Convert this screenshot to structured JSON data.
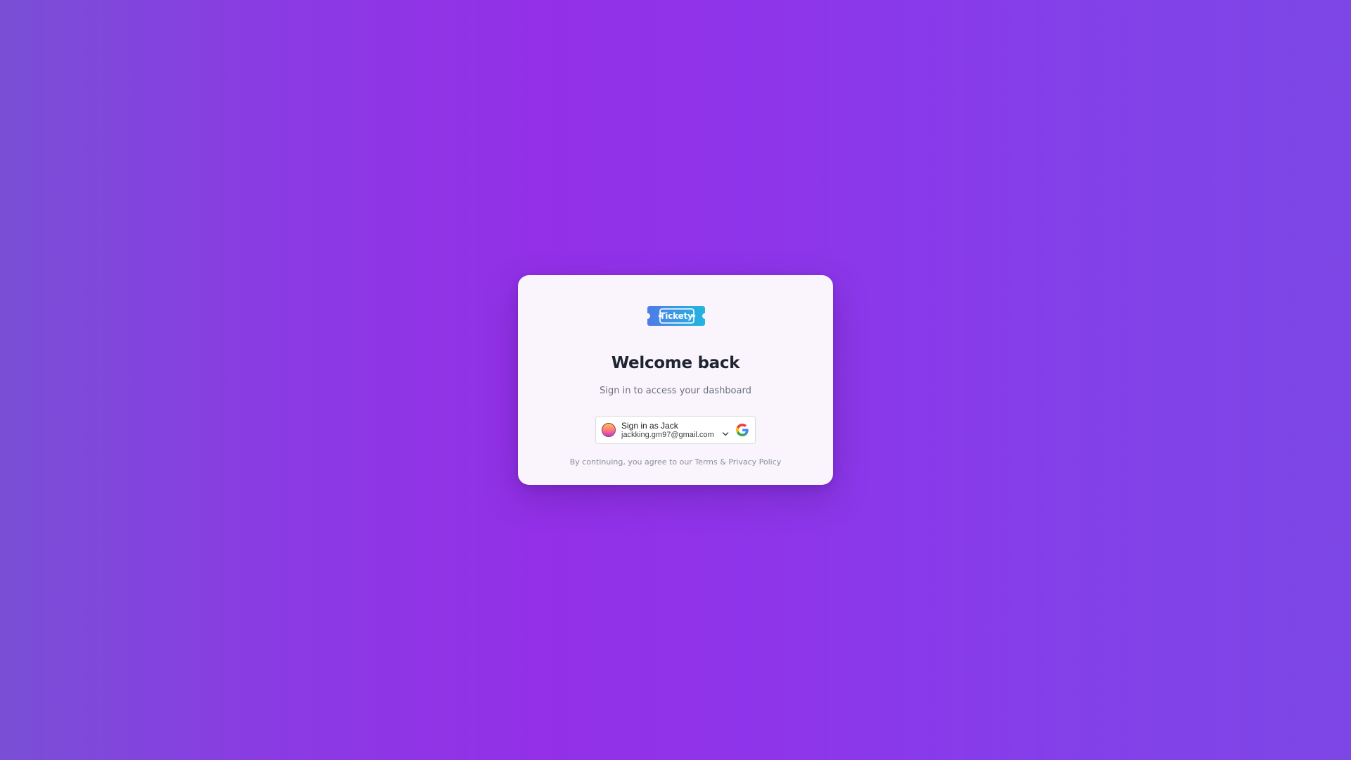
{
  "brand": {
    "logo_text": "Tickety",
    "logo_gradient": [
      "#4f7be8",
      "#22b6e0"
    ]
  },
  "login_card": {
    "title": "Welcome back",
    "subtitle": "Sign in to access your dashboard"
  },
  "google_signin": {
    "label": "Sign in as Jack",
    "email": "jackking.gm97@gmail.com",
    "avatar_icon": "avatar-icon",
    "dropdown_icon": "chevron-down-icon",
    "provider_icon": "google-icon"
  },
  "legal": {
    "prefix": "By continuing, you agree to our ",
    "terms_link": "Terms",
    "separator": " & ",
    "privacy_link": "Privacy Policy"
  },
  "colors": {
    "background_accent": "#9330e8",
    "card_background": "#faf5fc",
    "title_color": "#1f2433"
  }
}
